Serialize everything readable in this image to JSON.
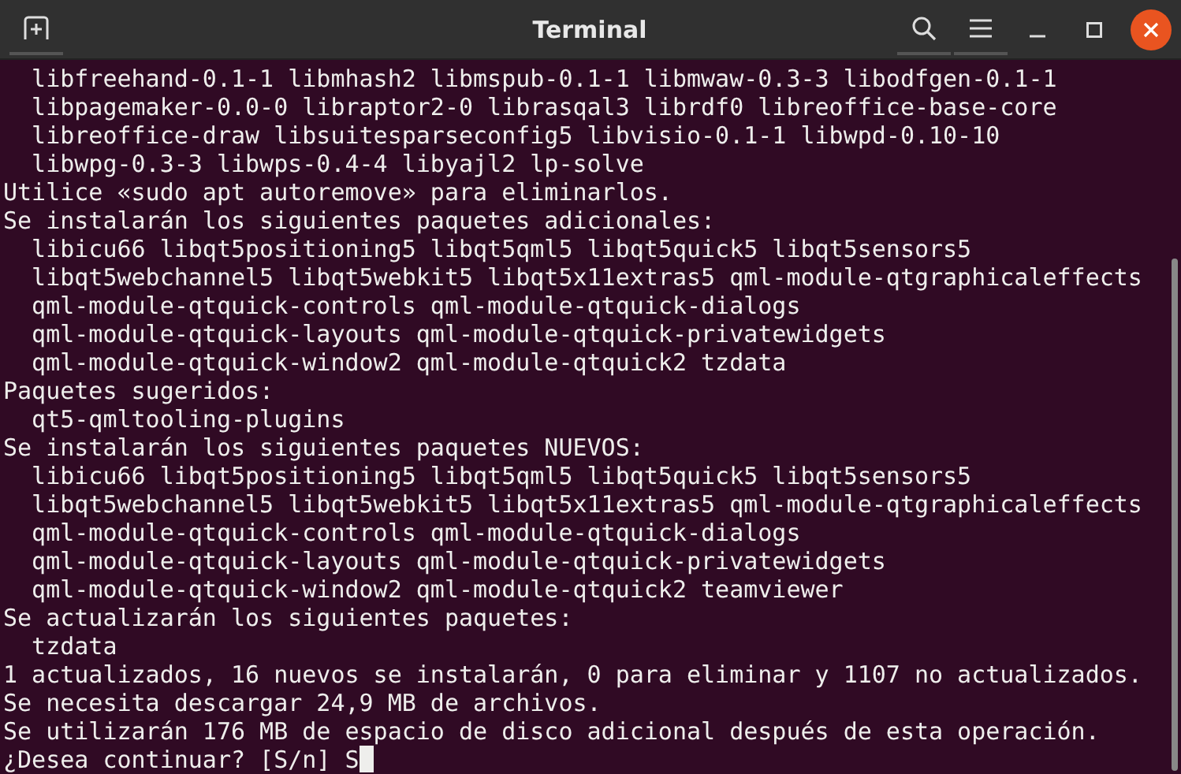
{
  "window": {
    "title": "Terminal"
  },
  "lines": [
    "  libfreehand-0.1-1 libmhash2 libmspub-0.1-1 libmwaw-0.3-3 libodfgen-0.1-1",
    "  libpagemaker-0.0-0 libraptor2-0 librasqal3 librdf0 libreoffice-base-core",
    "  libreoffice-draw libsuitesparseconfig5 libvisio-0.1-1 libwpd-0.10-10",
    "  libwpg-0.3-3 libwps-0.4-4 libyajl2 lp-solve",
    "Utilice «sudo apt autoremove» para eliminarlos.",
    "Se instalarán los siguientes paquetes adicionales:",
    "  libicu66 libqt5positioning5 libqt5qml5 libqt5quick5 libqt5sensors5",
    "  libqt5webchannel5 libqt5webkit5 libqt5x11extras5 qml-module-qtgraphicaleffects",
    "  qml-module-qtquick-controls qml-module-qtquick-dialogs",
    "  qml-module-qtquick-layouts qml-module-qtquick-privatewidgets",
    "  qml-module-qtquick-window2 qml-module-qtquick2 tzdata",
    "Paquetes sugeridos:",
    "  qt5-qmltooling-plugins",
    "Se instalarán los siguientes paquetes NUEVOS:",
    "  libicu66 libqt5positioning5 libqt5qml5 libqt5quick5 libqt5sensors5",
    "  libqt5webchannel5 libqt5webkit5 libqt5x11extras5 qml-module-qtgraphicaleffects",
    "  qml-module-qtquick-controls qml-module-qtquick-dialogs",
    "  qml-module-qtquick-layouts qml-module-qtquick-privatewidgets",
    "  qml-module-qtquick-window2 qml-module-qtquick2 teamviewer",
    "Se actualizarán los siguientes paquetes:",
    "  tzdata",
    "1 actualizados, 16 nuevos se instalarán, 0 para eliminar y 1107 no actualizados.",
    "Se necesita descargar 24,9 MB de archivos.",
    "Se utilizarán 176 MB de espacio de disco adicional después de esta operación."
  ],
  "prompt": "¿Desea continuar? [S/n] S"
}
